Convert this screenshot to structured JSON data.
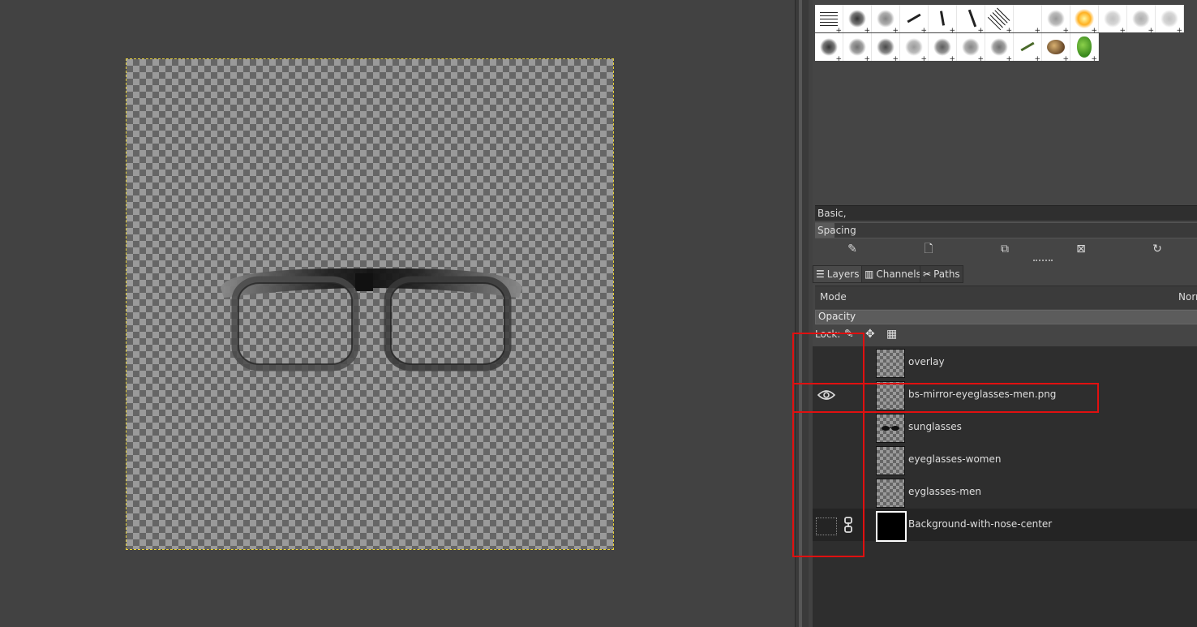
{
  "brushes": {
    "selected_name": "Basic,",
    "spacing_label": "Spacing",
    "spacing_fraction": 0.05,
    "toolbar_icons": [
      "edit-brush-icon",
      "new-brush-icon",
      "duplicate-brush-icon",
      "delete-brush-icon",
      "refresh-brushes-icon"
    ]
  },
  "dock_tabs": [
    {
      "label": "Layers",
      "icon": "layers-icon"
    },
    {
      "label": "Channels",
      "icon": "channels-icon"
    },
    {
      "label": "Paths",
      "icon": "paths-icon"
    }
  ],
  "layers_panel": {
    "mode_label": "Mode",
    "mode_value": "Norn",
    "opacity_label": "Opacity",
    "lock_label": "Lock:",
    "layers": [
      {
        "name": "overlay",
        "visible": false
      },
      {
        "name": "bs-mirror-eyeglasses-men.png",
        "visible": true
      },
      {
        "name": "sunglasses",
        "visible": false
      },
      {
        "name": "eyeglasses-women",
        "visible": false
      },
      {
        "name": "eyglasses-men",
        "visible": false
      },
      {
        "name": "Background-with-nose-center",
        "visible": false,
        "linked": true
      }
    ]
  },
  "colors": {
    "canvas_bg": "#424242",
    "highlight": "#e01010",
    "selection_border": "#e8d23a"
  }
}
